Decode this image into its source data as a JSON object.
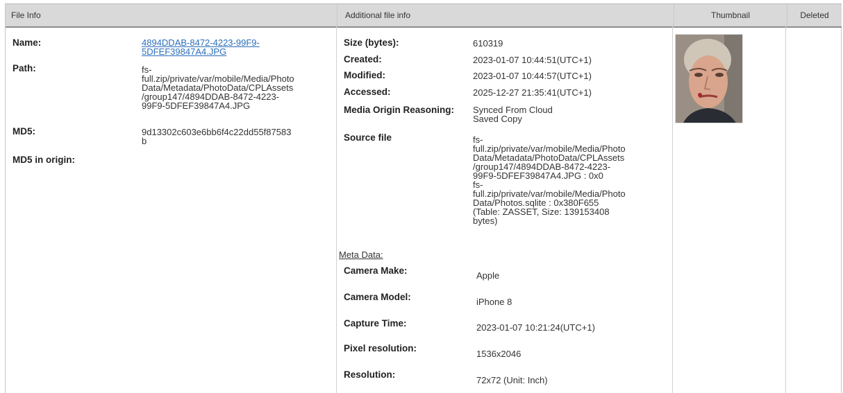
{
  "headers": {
    "file_info": "File Info",
    "additional": "Additional file info",
    "thumbnail": "Thumbnail",
    "deleted": "Deleted"
  },
  "file_info": {
    "name_label": "Name:",
    "name_value_line1": "4894DDAB-8472-4223-99F9-",
    "name_value_line2": "5DFEF39847A4.JPG",
    "path_label": "Path:",
    "path_lines": [
      "fs-",
      "full.zip/private/var/mobile/Media/Photo",
      "Data/Metadata/PhotoData/CPLAssets",
      "/group147/4894DDAB-8472-4223-",
      "99F9-5DFEF39847A4.JPG"
    ],
    "md5_label": "MD5:",
    "md5_lines": [
      "9d13302c603e6bb6f4c22dd55f87583",
      "b"
    ],
    "md5_origin_label": "MD5 in origin:"
  },
  "additional": {
    "size_label": "Size (bytes):",
    "size_value": "610319",
    "created_label": "Created:",
    "created_value": "2023-01-07 10:44:51(UTC+1)",
    "modified_label": "Modified:",
    "modified_value": "2023-01-07 10:44:57(UTC+1)",
    "accessed_label": "Accessed:",
    "accessed_value": "2025-12-27 21:35:41(UTC+1)",
    "origin_label": "Media Origin Reasoning:",
    "origin_lines": [
      "Synced From Cloud",
      "Saved Copy"
    ],
    "source_label": "Source file",
    "source_lines": [
      "fs-",
      "full.zip/private/var/mobile/Media/Photo",
      "Data/Metadata/PhotoData/CPLAssets",
      "/group147/4894DDAB-8472-4223-",
      "99F9-5DFEF39847A4.JPG : 0x0",
      "fs-",
      "full.zip/private/var/mobile/Media/Photo",
      "Data/Photos.sqlite : 0x380F655",
      "(Table: ZASSET, Size: 139153408",
      "bytes)"
    ],
    "meta_link": "Meta Data:",
    "camera_make_label": "Camera Make:",
    "camera_make_value": "Apple",
    "camera_model_label": "Camera Model:",
    "camera_model_value": "iPhone 8",
    "capture_label": "Capture Time:",
    "capture_value": "2023-01-07 10:21:24(UTC+1)",
    "pixel_res_label": "Pixel resolution:",
    "pixel_res_value": "1536x2046",
    "res_label": "Resolution:",
    "res_value": "72x72 (Unit: Inch)"
  },
  "thumbnail": {
    "icon": "photo-thumbnail",
    "colors": {
      "background": "#9a8f85",
      "skin": "#d9a58d",
      "hair": "#cfc6b8",
      "shirt": "#2a2c33"
    }
  }
}
